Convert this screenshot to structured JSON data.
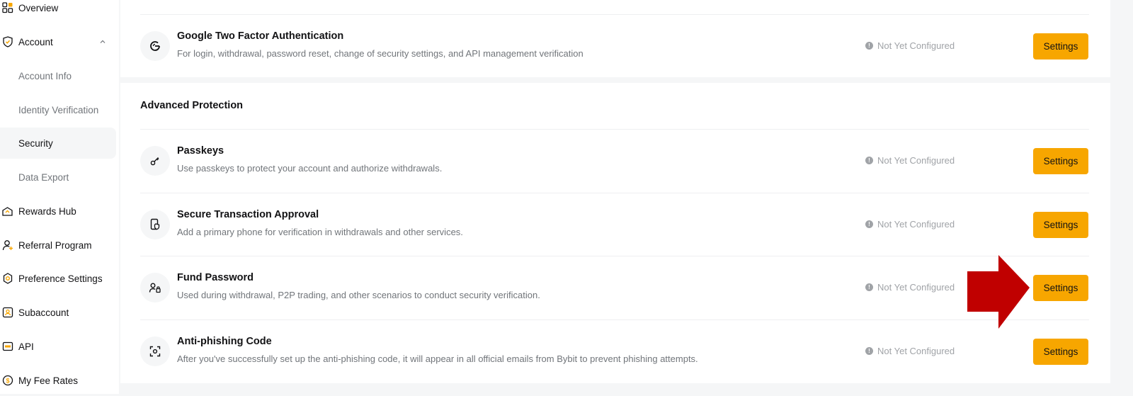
{
  "sidebar": {
    "items": [
      {
        "label": "Overview",
        "icon": "overview-icon"
      },
      {
        "label": "Account",
        "icon": "shield-icon"
      },
      {
        "label": "Account Info"
      },
      {
        "label": "Identity Verification"
      },
      {
        "label": "Security"
      },
      {
        "label": "Data Export"
      },
      {
        "label": "Rewards Hub",
        "icon": "gift-icon"
      },
      {
        "label": "Referral Program",
        "icon": "user-add-icon"
      },
      {
        "label": "Preference Settings",
        "icon": "gear-icon"
      },
      {
        "label": "Subaccount",
        "icon": "subaccount-icon"
      },
      {
        "label": "API",
        "icon": "api-icon"
      },
      {
        "label": "My Fee Rates",
        "icon": "dollar-icon"
      }
    ]
  },
  "security": {
    "google_2fa": {
      "title": "Google Two Factor Authentication",
      "desc": "For login, withdrawal, password reset, change of security settings, and API management verification",
      "status": "Not Yet Configured",
      "button": "Settings",
      "icon": "google-icon"
    },
    "advanced_title": "Advanced Protection",
    "advanced": [
      {
        "title": "Passkeys",
        "desc": "Use passkeys to protect your account and authorize withdrawals.",
        "status": "Not Yet Configured",
        "button": "Settings",
        "icon": "key-icon"
      },
      {
        "title": "Secure Transaction Approval",
        "desc": "Add a primary phone for verification in withdrawals and other services.",
        "status": "Not Yet Configured",
        "button": "Settings",
        "icon": "phone-shield-icon"
      },
      {
        "title": "Fund Password",
        "desc": "Used during withdrawal, P2P trading, and other scenarios to conduct security verification.",
        "status": "Not Yet Configured",
        "button": "Settings",
        "icon": "user-lock-icon"
      },
      {
        "title": "Anti-phishing Code",
        "desc": "After you've successfully set up the anti-phishing code, it will appear in all official emails from Bybit to prevent phishing attempts.",
        "status": "Not Yet Configured",
        "button": "Settings",
        "icon": "scan-icon"
      }
    ]
  },
  "colors": {
    "accent": "#f7a600",
    "annotation_arrow": "#c00000",
    "muted_text": "#71757a",
    "status_text": "#a0a3a7"
  }
}
